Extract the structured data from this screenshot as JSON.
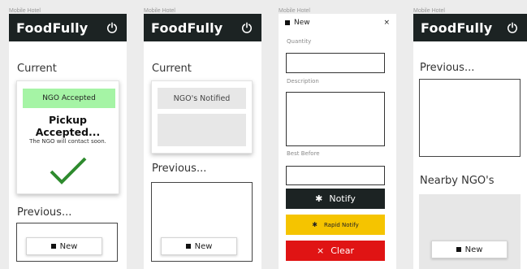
{
  "frame_label": "Mobile Hotel",
  "app": {
    "logo": "FoodFully"
  },
  "screen1": {
    "current_heading": "Current",
    "status_badge": "NGO Accepted",
    "pickup_title": "Pickup Accepted...",
    "pickup_subtitle": "The NGO will contact soon.",
    "previous_heading": "Previous...",
    "new_button": "New"
  },
  "screen2": {
    "current_heading": "Current",
    "status_badge": "NGO's Notified",
    "previous_heading": "Previous...",
    "new_button": "New"
  },
  "screen3": {
    "form_title": "New",
    "close": "×",
    "quantity_label": "Quantity",
    "description_label": "Description",
    "best_before_label": "Best Before",
    "notify_button": "Notify",
    "rapid_notify_button": "Rapid Notify",
    "clear_button": "Clear",
    "clear_icon": "×"
  },
  "screen4": {
    "previous_heading": "Previous...",
    "nearby_heading": "Nearby NGO's",
    "new_button": "New"
  },
  "colors": {
    "header": "#1c2323",
    "accepted_badge": "#a5f4a5",
    "check": "#2e8b2e",
    "rapid_notify": "#f5c400",
    "clear": "#e01414"
  }
}
